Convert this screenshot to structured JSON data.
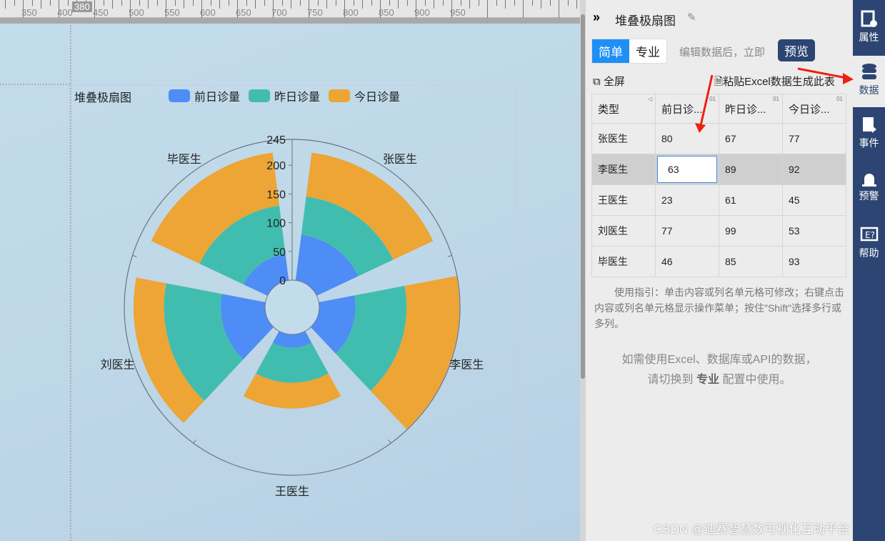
{
  "ruler": {
    "labels": [
      "350",
      "400",
      "450",
      "500",
      "550",
      "600",
      "650",
      "700",
      "750",
      "800",
      "850",
      "900",
      "950"
    ],
    "cursor": "380"
  },
  "chart_data": {
    "type": "polar-stacked-bar",
    "title": "堆叠极扇图",
    "categories": [
      "张医生",
      "李医生",
      "王医生",
      "刘医生",
      "毕医生"
    ],
    "series": [
      {
        "name": "前日诊量",
        "color": "#4e8cf6",
        "values": [
          80,
          63,
          23,
          77,
          46
        ]
      },
      {
        "name": "昨日诊量",
        "color": "#41bdaf",
        "values": [
          67,
          89,
          61,
          99,
          85
        ]
      },
      {
        "name": "今日诊量",
        "color": "#eda535",
        "values": [
          77,
          92,
          45,
          53,
          93
        ]
      }
    ],
    "radial_ticks": [
      "0",
      "50",
      "100",
      "150",
      "200",
      "245"
    ],
    "rmax": 245
  },
  "panel": {
    "title": "堆叠极扇图",
    "mode_simple": "简单",
    "mode_pro": "专业",
    "hint": "编辑数据后，立即",
    "preview": "预览",
    "fullscreen": "全屏",
    "paste": "粘贴Excel数据生成此表",
    "headers": [
      "类型",
      "前日诊...",
      "昨日诊...",
      "今日诊..."
    ],
    "rows": [
      [
        "张医生",
        "80",
        "67",
        "77"
      ],
      [
        "李医生",
        "63",
        "89",
        "92"
      ],
      [
        "王医生",
        "23",
        "61",
        "45"
      ],
      [
        "刘医生",
        "77",
        "99",
        "53"
      ],
      [
        "毕医生",
        "46",
        "85",
        "93"
      ]
    ],
    "guide": "使用指引：单击内容或列名单元格可修改；右键点击内容或列名单元格显示操作菜单；按住\"Shift\"选择多行或多列。",
    "note1": "如需使用Excel、数据库或API的数据，",
    "note2a": "请切换到 ",
    "note2b": "专业",
    "note2c": " 配置中使用。"
  },
  "sidebar": [
    {
      "label": "属性"
    },
    {
      "label": "数据"
    },
    {
      "label": "事件"
    },
    {
      "label": "预警"
    },
    {
      "label": "帮助"
    }
  ],
  "watermark": "CSDN @迪赛智慧数可视化互动平台"
}
